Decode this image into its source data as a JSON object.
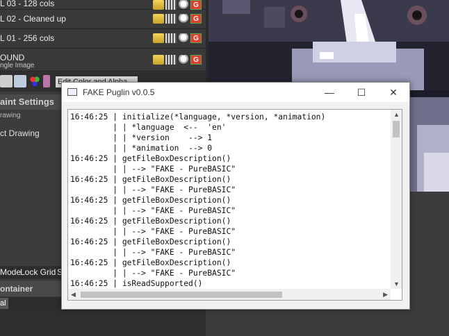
{
  "layers": [
    {
      "name": "L 03 - 128 cols",
      "sub": ""
    },
    {
      "name": "L 02 - Cleaned up",
      "sub": ""
    },
    {
      "name": "L 01 - 256 cols",
      "sub": ""
    },
    {
      "name": "OUND",
      "sub": "ngle Image"
    }
  ],
  "toolbar": {
    "select_value": "Edit Color and Alpha"
  },
  "left_panel": {
    "paint_settings_header": "aint Settings",
    "drawing_label": "rawing",
    "act_drawing_label": "ct Drawing",
    "grid_bar": {
      "mode": "Mode",
      "lock_grid": "Lock Grid",
      "s": "S"
    },
    "container_header": "ontainer",
    "tab_label": "al"
  },
  "window": {
    "title": "FAKE Puglin v0.0.5",
    "minimize": "—",
    "maximize": "☐",
    "close": "✕",
    "log_lines": [
      "16:46:25 | initialize(*language, *version, *animation)",
      "         | | *language  <--  'en'",
      "         | | *version    --> 1",
      "         | | *animation  --> 0",
      "16:46:25 | getFileBoxDescription()",
      "         | | --> \"FAKE - PureBASIC\"",
      "16:46:25 | getFileBoxDescription()",
      "         | | --> \"FAKE - PureBASIC\"",
      "16:46:25 | getFileBoxDescription()",
      "         | | --> \"FAKE - PureBASIC\"",
      "16:46:25 | getFileBoxDescription()",
      "         | | --> \"FAKE - PureBASIC\"",
      "16:46:25 | getFileBoxDescription()",
      "         | | --> \"FAKE - PureBASIC\"",
      "16:46:25 | getFileBoxDescription()",
      "         | | --> \"FAKE - PureBASIC\"",
      "16:46:25 | isReadSupported()"
    ]
  },
  "icons": {
    "layer_row": [
      "lock-icon",
      "pixel-icon",
      "bulb-icon",
      "g-icon"
    ],
    "window": "window-icon"
  }
}
